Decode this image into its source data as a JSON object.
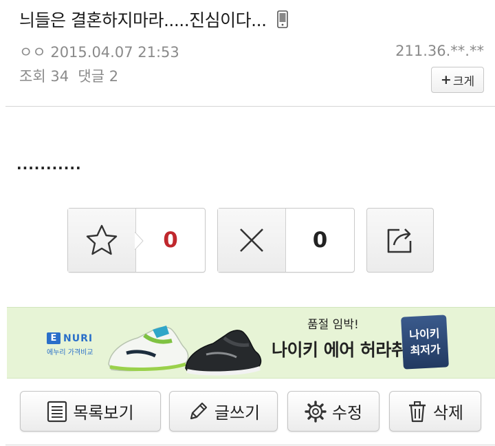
{
  "post": {
    "title": "늬들은 결혼하지마라.....진심이다...",
    "author": "ㅇㅇ",
    "date": "2015.04.07 21:53",
    "ip": "211.36.**.**",
    "views_label": "조회",
    "views": "34",
    "comments_label": "댓글",
    "comments": "2",
    "enlarge_label": "크게",
    "body": "..........."
  },
  "votes": {
    "recommend_count": "0",
    "dislike_count": "0"
  },
  "ad": {
    "logo_mark": "E",
    "logo_text": "NURI",
    "logo_sub": "에누리 가격비교",
    "subtitle": "품절 임박!",
    "headline": "나이키 에어 허라취",
    "badge_line1": "나이키",
    "badge_line2": "최저가"
  },
  "actions": {
    "list": "목록보기",
    "write": "글쓰기",
    "edit": "수정",
    "delete": "삭제"
  },
  "colors": {
    "recommend_count": "#c0282d",
    "ad_background": "#e7f4d6",
    "meta_text": "#8a8a8a"
  }
}
